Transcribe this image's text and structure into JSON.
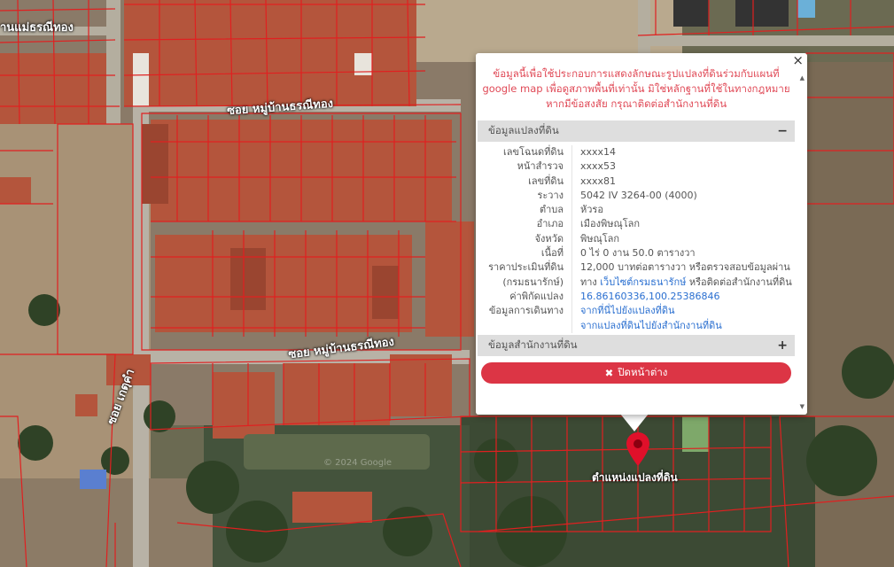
{
  "map": {
    "road_labels": [
      "ซอย หมู่บ้านธรณีทอง",
      "ซอย หมู่บ้านธรณีทอง",
      "ซอย เกตุคำ",
      "านแม่ธรณีทอง"
    ],
    "watermark": "© 2024 Google",
    "marker_label": "ตำแหน่งแปลงที่ดิน",
    "marker_icon": "map-pin-icon",
    "parcel_color": "#e02020"
  },
  "popup": {
    "close_glyph": "×",
    "disclaimer": "ข้อมูลนี้เพื่อใช้ประกอบการแสดงลักษณะรูปแปลงที่ดินร่วมกับแผนที่ google map เพื่อดูสภาพพื้นที่เท่านั้น มิใช่หลักฐานที่ใช้ในทางกฎหมาย หากมีข้อสงสัย กรุณาติดต่อสำนักงานที่ดิน",
    "section_parcel": {
      "title": "ข้อมูลแปลงที่ดิน",
      "toggle": "−"
    },
    "rows": {
      "deed_no": {
        "label": "เลขโฉนดที่ดิน",
        "value": "xxxx14"
      },
      "survey_page": {
        "label": "หน้าสำรวจ",
        "value": "xxxx53"
      },
      "land_no": {
        "label": "เลขที่ดิน",
        "value": "xxxx81"
      },
      "sheet": {
        "label": "ระวาง",
        "value": "5042 IV 3264-00 (4000)"
      },
      "subdistrict": {
        "label": "ตำบล",
        "value": "หัวรอ"
      },
      "district": {
        "label": "อำเภอ",
        "value": "เมืองพิษณุโลก"
      },
      "province": {
        "label": "จังหวัด",
        "value": "พิษณุโลก"
      },
      "area": {
        "label": "เนื้อที่",
        "value": "0 ไร่ 0 งาน 50.0 ตารางวา"
      },
      "price": {
        "label1": "ราคาประเมินที่ดิน",
        "label2": "(กรมธนารักษ์)",
        "value1": "12,000 บาทต่อตารางวา หรือตรวจสอบข้อมูลผ่าน",
        "value2_pre": "ทาง ",
        "value2_link": "เว็บไซต์กรมธนารักษ์",
        "value2_post": " หรือติดต่อสำนักงานที่ดิน"
      },
      "coords": {
        "label": "ค่าพิกัดแปลง",
        "value": "16.86160336,100.25386846"
      },
      "directions": {
        "label": "ข้อมูลการเดินทาง",
        "link1": "จากที่นี่ไปยังแปลงที่ดิน",
        "link2": "จากแปลงที่ดินไปยังสำนักงานที่ดิน"
      }
    },
    "section_office": {
      "title": "ข้อมูลสำนักงานที่ดิน",
      "toggle": "+"
    },
    "close_button": {
      "icon": "close-icon",
      "glyph": "✖",
      "label": "ปิดหน้าต่าง"
    },
    "colors": {
      "disclaimer": "#e04a57",
      "button": "#dc3545",
      "link": "#2a6fd0"
    }
  }
}
